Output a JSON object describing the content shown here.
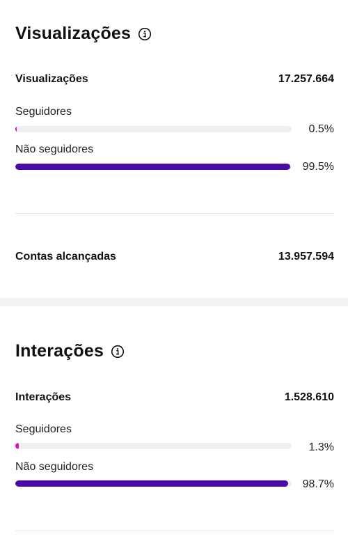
{
  "views": {
    "title": "Visualizações",
    "total_label": "Visualizações",
    "total_value": "17.257.664",
    "followers": {
      "label": "Seguidores",
      "percent_text": "0.5%",
      "percent": 0.5
    },
    "non_followers": {
      "label": "Não seguidores",
      "percent_text": "99.5%",
      "percent": 99.5
    },
    "reach_label": "Contas alcançadas",
    "reach_value": "13.957.594"
  },
  "interactions": {
    "title": "Interações",
    "total_label": "Interações",
    "total_value": "1.528.610",
    "followers": {
      "label": "Seguidores",
      "percent_text": "1.3%",
      "percent": 1.3
    },
    "non_followers": {
      "label": "Não seguidores",
      "percent_text": "98.7%",
      "percent": 98.7
    }
  },
  "colors": {
    "followers_bar": "#d614b8",
    "non_followers_bar": "#4a0aa8",
    "track": "#efefef"
  },
  "icons": {
    "title_info": "info-icon"
  }
}
